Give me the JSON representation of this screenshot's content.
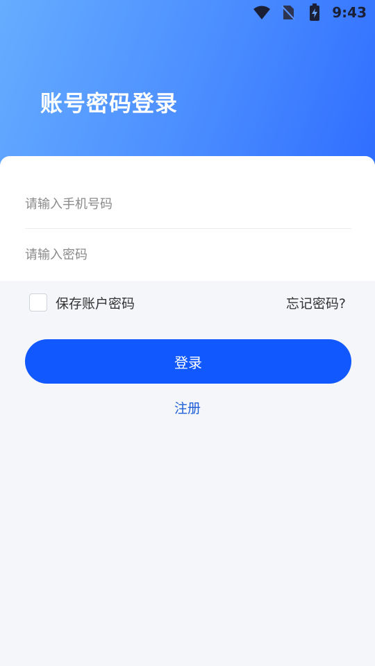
{
  "status_bar": {
    "time": "9:43",
    "icons": [
      "wifi-icon",
      "no-sim-icon",
      "battery-charging-icon"
    ]
  },
  "header": {
    "title": "账号密码登录"
  },
  "form": {
    "phone_placeholder": "请输入手机号码",
    "password_placeholder": "请输入密码",
    "phone_value": "",
    "password_value": ""
  },
  "options": {
    "remember_label": "保存账户密码",
    "remember_checked": false,
    "forgot_label": "忘记密码?"
  },
  "actions": {
    "login_label": "登录",
    "register_label": "注册"
  },
  "colors": {
    "primary": "#1159ff",
    "link": "#1c5fd6",
    "header_gradient_start": "#66adff",
    "header_gradient_end": "#2f6dff",
    "background": "#f5f6fa"
  }
}
